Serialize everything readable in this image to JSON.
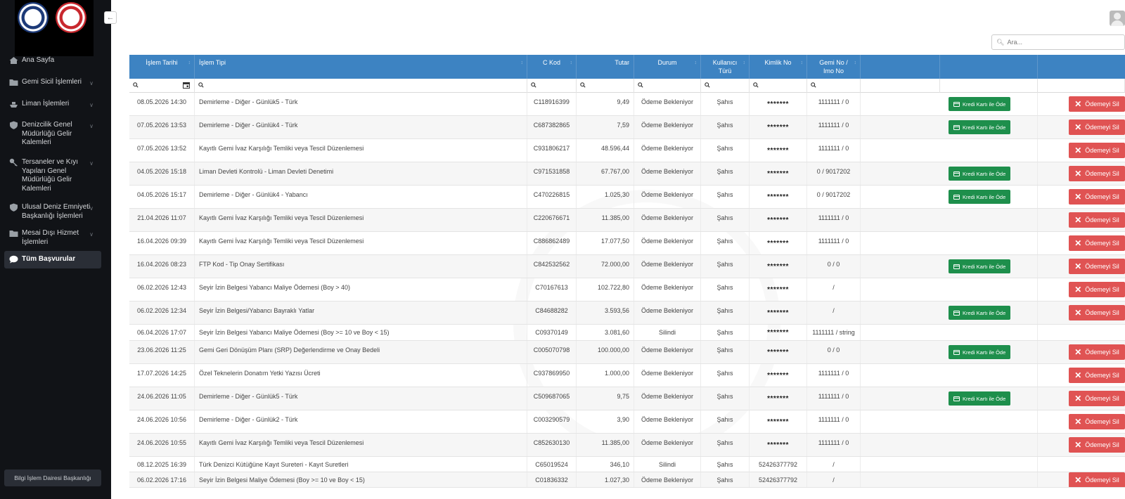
{
  "sidebar": {
    "items": [
      {
        "label": "Ana Sayfa",
        "icon": "home-icon",
        "expandable": false
      },
      {
        "label": "Gemi Sicil İşlemleri",
        "icon": "folder-icon",
        "expandable": true
      },
      {
        "label": "Liman İşlemleri",
        "icon": "ship-icon",
        "expandable": true
      },
      {
        "label": "Denizcilik Genel Müdürlüğü Gelir Kalemleri",
        "icon": "shield-icon",
        "expandable": true
      },
      {
        "label": "Tersaneler ve Kıyı Yapıları Genel Müdürlüğü Gelir Kalemleri",
        "icon": "key-icon",
        "expandable": true
      },
      {
        "label": "Ulusal Deniz Emniyeti Başkanlığı İşlemleri",
        "icon": "shield-icon",
        "expandable": true
      },
      {
        "label": "Mesai Dışı Hizmet İşlemleri",
        "icon": "folder-icon",
        "expandable": true
      },
      {
        "label": "Tüm Başvurular",
        "icon": "chat-icon",
        "expandable": false,
        "active": true
      }
    ],
    "footer": "Bilgi İşlem Dairesi Başkanlığı"
  },
  "search": {
    "placeholder": "Ara..."
  },
  "table": {
    "columns": [
      "İşlem Tarihi",
      "İşlem Tipi",
      "C Kod",
      "Tutar",
      "Durum",
      "Kullanıcı Türü",
      "Kimlik No",
      "Gemi No / Imo No",
      "",
      ""
    ],
    "pay_label": "Kredi Kartı ile Öde",
    "delete_label": "Ödemeyi Sil",
    "rows": [
      {
        "date": "08.05.2026 14:30",
        "type": "Demirleme - Diğer - Günlük5 - Türk",
        "ckod": "C118916399",
        "tutar": "9,49",
        "durum": "Ödeme Bekleniyor",
        "kullanici": "Şahıs",
        "kimlik": "*******",
        "gemi": "1111111 / 0",
        "pay": true,
        "del": true
      },
      {
        "date": "07.05.2026 13:53",
        "type": "Demirleme - Diğer - Günlük4 - Türk",
        "ckod": "C687382865",
        "tutar": "7,59",
        "durum": "Ödeme Bekleniyor",
        "kullanici": "Şahıs",
        "kimlik": "*******",
        "gemi": "1111111 / 0",
        "pay": true,
        "del": true
      },
      {
        "date": "07.05.2026 13:52",
        "type": "Kayıtlı Gemi İvaz Karşılığı Temliki veya Tescil Düzenlemesi",
        "ckod": "C931806217",
        "tutar": "48.596,44",
        "durum": "Ödeme Bekleniyor",
        "kullanici": "Şahıs",
        "kimlik": "*******",
        "gemi": "1111111 / 0",
        "pay": false,
        "del": true
      },
      {
        "date": "04.05.2026 15:18",
        "type": "Liman Devleti Kontrolü - Liman Devleti Denetimi",
        "ckod": "C971531858",
        "tutar": "67.767,00",
        "durum": "Ödeme Bekleniyor",
        "kullanici": "Şahıs",
        "kimlik": "*******",
        "gemi": "0 / 9017202",
        "pay": true,
        "del": true
      },
      {
        "date": "04.05.2026 15:17",
        "type": "Demirleme - Diğer - Günlük4 - Yabancı",
        "ckod": "C470226815",
        "tutar": "1.025,30",
        "durum": "Ödeme Bekleniyor",
        "kullanici": "Şahıs",
        "kimlik": "*******",
        "gemi": "0 / 9017202",
        "pay": true,
        "del": true
      },
      {
        "date": "21.04.2026 11:07",
        "type": "Kayıtlı Gemi İvaz Karşılığı Temliki veya Tescil Düzenlemesi",
        "ckod": "C220676671",
        "tutar": "11.385,00",
        "durum": "Ödeme Bekleniyor",
        "kullanici": "Şahıs",
        "kimlik": "*******",
        "gemi": "1111111 / 0",
        "pay": false,
        "del": true
      },
      {
        "date": "16.04.2026 09:39",
        "type": "Kayıtlı Gemi İvaz Karşılığı Temliki veya Tescil Düzenlemesi",
        "ckod": "C886862489",
        "tutar": "17.077,50",
        "durum": "Ödeme Bekleniyor",
        "kullanici": "Şahıs",
        "kimlik": "*******",
        "gemi": "1111111 / 0",
        "pay": false,
        "del": true
      },
      {
        "date": "16.04.2026 08:23",
        "type": "FTP Kod - Tip Onay Sertifikası",
        "ckod": "C842532562",
        "tutar": "72.000,00",
        "durum": "Ödeme Bekleniyor",
        "kullanici": "Şahıs",
        "kimlik": "*******",
        "gemi": "0 / 0",
        "pay": true,
        "del": true
      },
      {
        "date": "06.02.2026 12:43",
        "type": "Seyir İzin Belgesi Yabancı Maliye Ödemesi (Boy > 40)",
        "ckod": "C70167613",
        "tutar": "102.722,80",
        "durum": "Ödeme Bekleniyor",
        "kullanici": "Şahıs",
        "kimlik": "*******",
        "gemi": "/",
        "pay": false,
        "del": true
      },
      {
        "date": "06.02.2026 12:34",
        "type": "Seyir İzin Belgesi/Yabancı Bayraklı Yatlar",
        "ckod": "C84688282",
        "tutar": "3.593,56",
        "durum": "Ödeme Bekleniyor",
        "kullanici": "Şahıs",
        "kimlik": "*******",
        "gemi": "/",
        "pay": true,
        "del": true
      },
      {
        "date": "06.04.2026 17:07",
        "type": "Seyir İzin Belgesi Yabancı Maliye Ödemesi (Boy >= 10 ve Boy < 15)",
        "ckod": "C09370149",
        "tutar": "3.081,60",
        "durum": "Silindi",
        "kullanici": "Şahıs",
        "kimlik": "*******",
        "gemi": "1111111 / string",
        "pay": false,
        "del": false
      },
      {
        "date": "23.06.2026 11:25",
        "type": "Gemi Geri Dönüşüm Planı (SRP) Değerlendirme ve Onay Bedeli",
        "ckod": "C005070798",
        "tutar": "100.000,00",
        "durum": "Ödeme Bekleniyor",
        "kullanici": "Şahıs",
        "kimlik": "*******",
        "gemi": "0 / 0",
        "pay": true,
        "del": true
      },
      {
        "date": "17.07.2026 14:25",
        "type": "Özel Teknelerin Donatım Yetki Yazısı Ücreti",
        "ckod": "C937869950",
        "tutar": "1.000,00",
        "durum": "Ödeme Bekleniyor",
        "kullanici": "Şahıs",
        "kimlik": "*******",
        "gemi": "1111111 / 0",
        "pay": false,
        "del": true
      },
      {
        "date": "24.06.2026 11:05",
        "type": "Demirleme - Diğer - Günlük5 - Türk",
        "ckod": "C509687065",
        "tutar": "9,75",
        "durum": "Ödeme Bekleniyor",
        "kullanici": "Şahıs",
        "kimlik": "*******",
        "gemi": "1111111 / 0",
        "pay": true,
        "del": true
      },
      {
        "date": "24.06.2026 10:56",
        "type": "Demirleme - Diğer - Günlük2 - Türk",
        "ckod": "C003290579",
        "tutar": "3,90",
        "durum": "Ödeme Bekleniyor",
        "kullanici": "Şahıs",
        "kimlik": "*******",
        "gemi": "1111111 / 0",
        "pay": false,
        "del": true
      },
      {
        "date": "24.06.2026 10:55",
        "type": "Kayıtlı Gemi İvaz Karşılığı Temliki veya Tescil Düzenlemesi",
        "ckod": "C852630130",
        "tutar": "11.385,00",
        "durum": "Ödeme Bekleniyor",
        "kullanici": "Şahıs",
        "kimlik": "*******",
        "gemi": "1111111 / 0",
        "pay": false,
        "del": true
      },
      {
        "date": "08.12.2025 16:39",
        "type": "Türk Denizci Kütüğüne Kayıt Sureteri - Kayıt Suretleri",
        "ckod": "C65019524",
        "tutar": "346,10",
        "durum": "Silindi",
        "kullanici": "Şahıs",
        "kimlik": "52426377792",
        "gemi": "/",
        "pay": false,
        "del": false
      },
      {
        "date": "06.02.2026 17:16",
        "type": "Seyir İzin Belgesi Maliye Ödemesi (Boy >= 10 ve Boy < 15)",
        "ckod": "C01836332",
        "tutar": "1.027,30",
        "durum": "Ödeme Bekleniyor",
        "kullanici": "Şahıs",
        "kimlik": "52426377792",
        "gemi": "/",
        "pay": false,
        "del": true
      }
    ]
  }
}
